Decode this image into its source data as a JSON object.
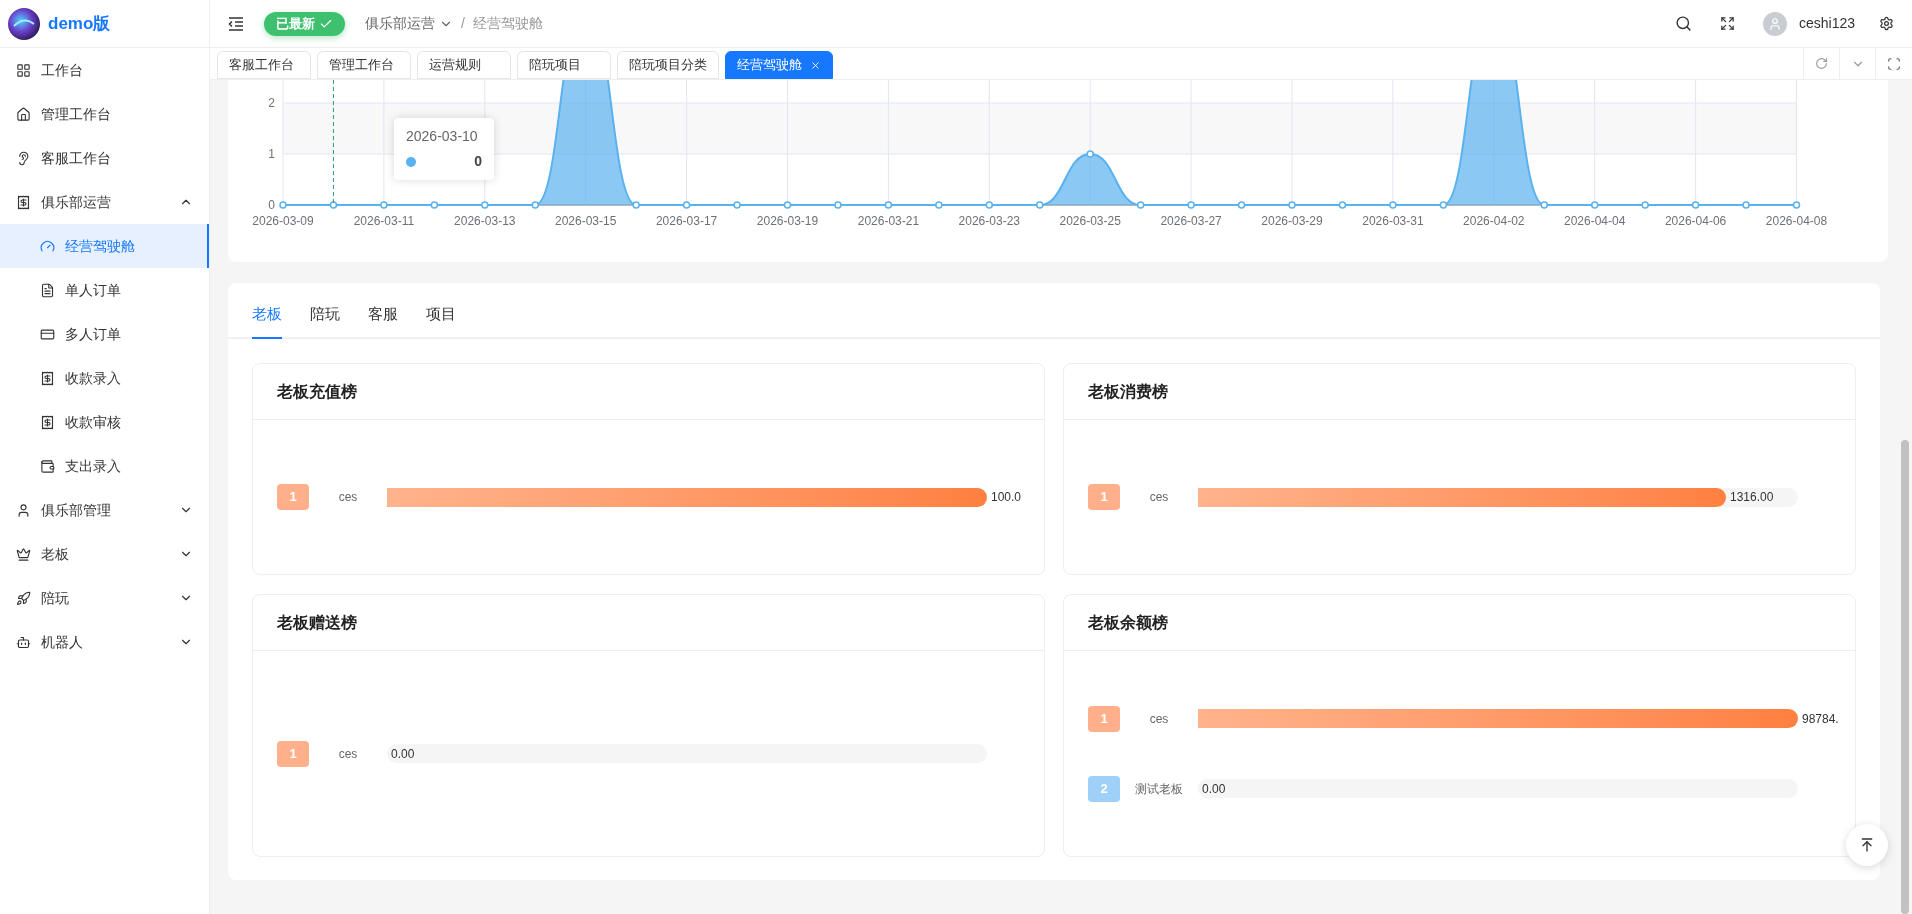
{
  "brand": {
    "title": "demo版"
  },
  "sidebar": {
    "items": [
      {
        "label": "工作台",
        "selected": false
      },
      {
        "label": "管理工作台",
        "selected": false
      },
      {
        "label": "客服工作台",
        "selected": false
      },
      {
        "label": "俱乐部运营",
        "selected": false,
        "expanded": true,
        "children": [
          {
            "label": "经营驾驶舱",
            "selected": true
          },
          {
            "label": "单人订单",
            "selected": false
          },
          {
            "label": "多人订单",
            "selected": false
          },
          {
            "label": "收款录入",
            "selected": false
          },
          {
            "label": "收款审核",
            "selected": false
          },
          {
            "label": "支出录入",
            "selected": false
          }
        ]
      },
      {
        "label": "俱乐部管理",
        "selected": false,
        "expanded": false
      },
      {
        "label": "老板",
        "selected": false,
        "expanded": false
      },
      {
        "label": "陪玩",
        "selected": false,
        "expanded": false
      },
      {
        "label": "机器人",
        "selected": false,
        "expanded": false
      }
    ]
  },
  "header": {
    "status_badge": "已最新",
    "breadcrumb": [
      "俱乐部运营",
      "经营驾驶舱"
    ],
    "breadcrumb_separator": "/",
    "username": "ceshi123"
  },
  "page_tabs": [
    {
      "label": "客服工作台",
      "selected": false
    },
    {
      "label": "管理工作台",
      "selected": false
    },
    {
      "label": "运营规则",
      "selected": false
    },
    {
      "label": "陪玩项目",
      "selected": false
    },
    {
      "label": "陪玩项目分类",
      "selected": false
    },
    {
      "label": "经营驾驶舱",
      "selected": true
    }
  ],
  "trend_chart": {
    "chart_data": {
      "type": "area",
      "x": [
        "2026-03-09",
        "2026-03-10",
        "2026-03-11",
        "2026-03-12",
        "2026-03-13",
        "2026-03-14",
        "2026-03-15",
        "2026-03-16",
        "2026-03-17",
        "2026-03-18",
        "2026-03-19",
        "2026-03-20",
        "2026-03-21",
        "2026-03-22",
        "2026-03-23",
        "2026-03-24",
        "2026-03-25",
        "2026-03-26",
        "2026-03-27",
        "2026-03-28",
        "2026-03-29",
        "2026-03-30",
        "2026-03-31",
        "2026-04-01",
        "2026-04-02",
        "2026-04-03",
        "2026-04-04",
        "2026-04-05",
        "2026-04-06",
        "2026-04-07",
        "2026-04-08"
      ],
      "series": [
        {
          "color": "#5ab1ef",
          "values": [
            0,
            0,
            0,
            0,
            0,
            0,
            null,
            0,
            0,
            0,
            0,
            0,
            0,
            0,
            0,
            0,
            1,
            0,
            0,
            0,
            0,
            0,
            0,
            0,
            null,
            0,
            0,
            0,
            0,
            0,
            0
          ]
        }
      ],
      "xticks": [
        "2026-03-09",
        "2026-03-11",
        "2026-03-13",
        "2026-03-15",
        "2026-03-17",
        "2026-03-19",
        "2026-03-21",
        "2026-03-23",
        "2026-03-25",
        "2026-03-27",
        "2026-03-29",
        "2026-03-31",
        "2026-04-02",
        "2026-04-04",
        "2026-04-06",
        "2026-04-08"
      ],
      "yticks": [
        0,
        1,
        2
      ],
      "xlim": [
        "2026-03-09",
        "2026-04-08"
      ],
      "ylim": [
        0,
        3
      ],
      "bands": [
        {
          "axis": "y",
          "from": 1,
          "to": 2
        }
      ],
      "ref_lines": [
        {
          "axis": "x",
          "value": "2026-03-10"
        }
      ],
      "grid": true
    },
    "tooltip": {
      "date": "2026-03-10",
      "value": "0"
    }
  },
  "rank_tabs": [
    {
      "label": "老板",
      "selected": true
    },
    {
      "label": "陪玩",
      "selected": false
    },
    {
      "label": "客服",
      "selected": false
    },
    {
      "label": "项目",
      "selected": false
    }
  ],
  "rank_cards": [
    {
      "title": "老板充值榜",
      "rows": [
        {
          "rank": "1",
          "name": "ces",
          "value": "100.0",
          "level": 1,
          "color": "#ffb08a"
        }
      ]
    },
    {
      "title": "老板消费榜",
      "rows": [
        {
          "rank": "1",
          "name": "ces",
          "value": "1316.00",
          "level": 0.88,
          "color": "#ffb08a"
        }
      ]
    },
    {
      "title": "老板赠送榜",
      "rows": [
        {
          "rank": "1",
          "name": "ces",
          "value": "0.00",
          "color": "#ffb08a"
        }
      ]
    },
    {
      "title": "老板余额榜",
      "rows": [
        {
          "rank": "1",
          "name": "ces",
          "value": "98784.",
          "level": 1,
          "color": "#ffb08a"
        },
        {
          "rank": "2",
          "name": "测试老板",
          "value": "0.00",
          "color": "#9fd0f7"
        }
      ]
    }
  ]
}
